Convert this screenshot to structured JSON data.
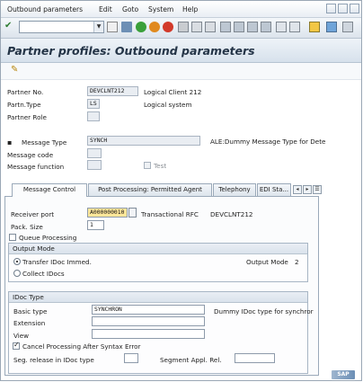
{
  "menu": {
    "items": [
      "Outbound parameters",
      "Edit",
      "Goto",
      "System",
      "Help"
    ]
  },
  "toolbar": {
    "command_field": "",
    "icons": [
      "enter-icon",
      "save-icon",
      "back-icon",
      "exit-icon",
      "cancel-icon",
      "print-icon",
      "find-icon",
      "find-next-icon",
      "first-page-icon",
      "previous-page-icon",
      "next-page-icon",
      "last-page-icon",
      "create-session-icon",
      "shortcut-icon",
      "help-icon",
      "customize-layout-icon"
    ]
  },
  "title": "Partner profiles: Outbound parameters",
  "header": {
    "partner_no_label": "Partner No.",
    "partner_no_value": "DEVCLNT212",
    "partner_no_desc": "Logical Client 212",
    "partn_type_label": "Partn.Type",
    "partn_type_value": "LS",
    "partn_type_desc": "Logical system",
    "partner_role_label": "Partner Role",
    "partner_role_value": ""
  },
  "message": {
    "type_label": "Message Type",
    "type_value": "SYNCH",
    "type_desc": "ALE:Dummy Message Type for Dete",
    "code_label": "Message code",
    "code_value": "",
    "function_label": "Message function",
    "function_value": "",
    "test_label": "Test"
  },
  "tabs": [
    "Message Control",
    "Post Processing: Permitted Agent",
    "Telephony",
    "EDI Sta..."
  ],
  "outbound": {
    "receiver_port_label": "Receiver port",
    "receiver_port_value": "A000000010",
    "receiver_port_type": "Transactional RFC",
    "receiver_port_desc": "DEVCLNT212",
    "pack_size_label": "Pack. Size",
    "pack_size_value": "1",
    "queue_processing_label": "Queue Processing"
  },
  "output_mode": {
    "header": "Output Mode",
    "transfer_label": "Transfer IDoc Immed.",
    "collect_label": "Collect IDocs",
    "output_mode_label": "Output Mode",
    "output_mode_value": "2"
  },
  "idoc": {
    "header": "IDoc Type",
    "basic_type_label": "Basic type",
    "basic_type_value": "SYNCHRON",
    "basic_type_desc": "Dummy IDoc type for synchror",
    "extension_label": "Extension",
    "extension_value": "",
    "view_label": "View",
    "view_value": "",
    "cancel_label": "Cancel Processing After Syntax Error",
    "seg_release_label": "Seg. release in IDoc type",
    "seg_release_value": "",
    "segment_appl_label": "Segment Appl. Rel.",
    "segment_appl_value": ""
  },
  "colors": {
    "title_text": "#243447",
    "port_highlight": "#ffe79a",
    "panel_bg": "#fbfcfd"
  },
  "logo_text": "SAP"
}
